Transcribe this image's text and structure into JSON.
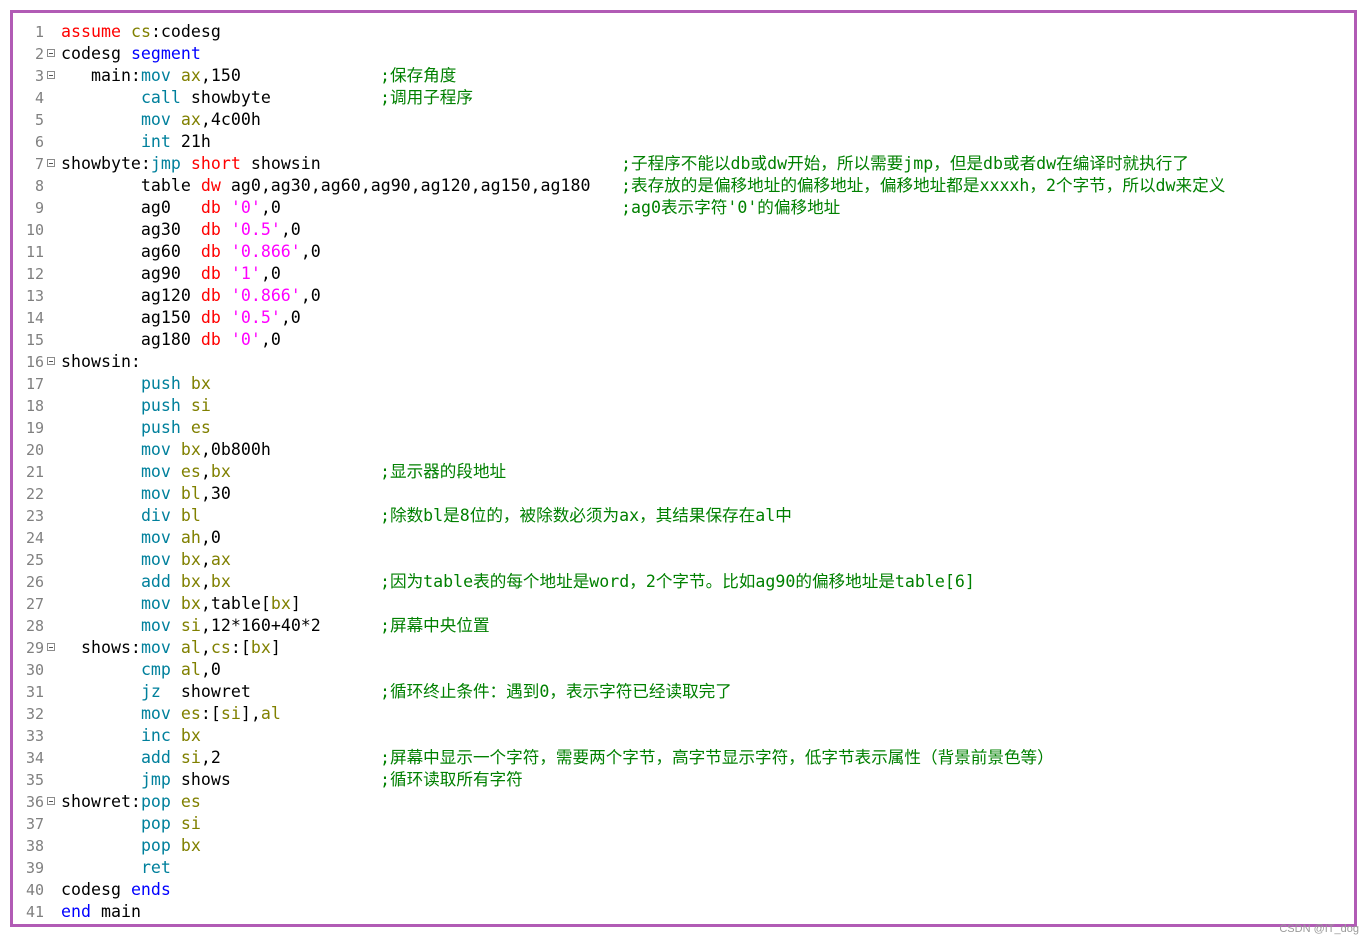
{
  "colors": {
    "border": "#b15bb5",
    "line_number": "#808080",
    "keyword": "#0000ff",
    "instruction": "#00809c",
    "directive_red": "#ff0000",
    "register": "#808000",
    "string": "#ff00ff",
    "comment": "#008000",
    "plain": "#000000"
  },
  "editor": {
    "lines": [
      {
        "num": "1",
        "fold": false,
        "tokens": [
          {
            "t": "assume",
            "c": "r"
          },
          {
            "t": " ",
            "c": "p"
          },
          {
            "t": "cs",
            "c": "o"
          },
          {
            "t": ":codesg",
            "c": "p"
          }
        ],
        "comment": "",
        "col": 1
      },
      {
        "num": "2",
        "fold": true,
        "tokens": [
          {
            "t": "codesg ",
            "c": "p"
          },
          {
            "t": "segment",
            "c": "b"
          }
        ],
        "comment": "",
        "col": 1
      },
      {
        "num": "3",
        "fold": true,
        "tokens": [
          {
            "t": "   main:",
            "c": "p"
          },
          {
            "t": "mov",
            "c": "i"
          },
          {
            "t": " ",
            "c": "p"
          },
          {
            "t": "ax",
            "c": "o"
          },
          {
            "t": ",150",
            "c": "p"
          }
        ],
        "comment": ";保存角度",
        "col": 1
      },
      {
        "num": "4",
        "fold": false,
        "tokens": [
          {
            "t": "        ",
            "c": "p"
          },
          {
            "t": "call",
            "c": "i"
          },
          {
            "t": " showbyte",
            "c": "p"
          }
        ],
        "comment": ";调用子程序",
        "col": 1
      },
      {
        "num": "5",
        "fold": false,
        "tokens": [
          {
            "t": "        ",
            "c": "p"
          },
          {
            "t": "mov",
            "c": "i"
          },
          {
            "t": " ",
            "c": "p"
          },
          {
            "t": "ax",
            "c": "o"
          },
          {
            "t": ",4c00h",
            "c": "p"
          }
        ],
        "comment": "",
        "col": 1
      },
      {
        "num": "6",
        "fold": false,
        "tokens": [
          {
            "t": "        ",
            "c": "p"
          },
          {
            "t": "int",
            "c": "i"
          },
          {
            "t": " 21h",
            "c": "p"
          }
        ],
        "comment": "",
        "col": 1
      },
      {
        "num": "7",
        "fold": true,
        "tokens": [
          {
            "t": "showbyte:",
            "c": "p"
          },
          {
            "t": "jmp",
            "c": "i"
          },
          {
            "t": " ",
            "c": "p"
          },
          {
            "t": "short",
            "c": "r"
          },
          {
            "t": " showsin",
            "c": "p"
          }
        ],
        "comment": ";子程序不能以db或dw开始，所以需要jmp，但是db或者dw在编译时就执行了",
        "col": 2
      },
      {
        "num": "8",
        "fold": false,
        "tokens": [
          {
            "t": "        table ",
            "c": "p"
          },
          {
            "t": "dw",
            "c": "r"
          },
          {
            "t": " ag0,ag30,ag60,ag90,ag120,ag150,ag180",
            "c": "p"
          }
        ],
        "comment": ";表存放的是偏移地址的偏移地址，偏移地址都是xxxxh，2个字节，所以dw来定义",
        "col": 2
      },
      {
        "num": "9",
        "fold": false,
        "tokens": [
          {
            "t": "        ag0   ",
            "c": "p"
          },
          {
            "t": "db",
            "c": "r"
          },
          {
            "t": " ",
            "c": "p"
          },
          {
            "t": "'0'",
            "c": "s"
          },
          {
            "t": ",0",
            "c": "p"
          }
        ],
        "comment": ";ag0表示字符'0'的偏移地址",
        "col": 2
      },
      {
        "num": "10",
        "fold": false,
        "tokens": [
          {
            "t": "        ag30  ",
            "c": "p"
          },
          {
            "t": "db",
            "c": "r"
          },
          {
            "t": " ",
            "c": "p"
          },
          {
            "t": "'0.5'",
            "c": "s"
          },
          {
            "t": ",0",
            "c": "p"
          }
        ],
        "comment": "",
        "col": 2
      },
      {
        "num": "11",
        "fold": false,
        "tokens": [
          {
            "t": "        ag60  ",
            "c": "p"
          },
          {
            "t": "db",
            "c": "r"
          },
          {
            "t": " ",
            "c": "p"
          },
          {
            "t": "'0.866'",
            "c": "s"
          },
          {
            "t": ",0",
            "c": "p"
          }
        ],
        "comment": "",
        "col": 2
      },
      {
        "num": "12",
        "fold": false,
        "tokens": [
          {
            "t": "        ag90  ",
            "c": "p"
          },
          {
            "t": "db",
            "c": "r"
          },
          {
            "t": " ",
            "c": "p"
          },
          {
            "t": "'1'",
            "c": "s"
          },
          {
            "t": ",0",
            "c": "p"
          }
        ],
        "comment": "",
        "col": 2
      },
      {
        "num": "13",
        "fold": false,
        "tokens": [
          {
            "t": "        ag120 ",
            "c": "p"
          },
          {
            "t": "db",
            "c": "r"
          },
          {
            "t": " ",
            "c": "p"
          },
          {
            "t": "'0.866'",
            "c": "s"
          },
          {
            "t": ",0",
            "c": "p"
          }
        ],
        "comment": "",
        "col": 2
      },
      {
        "num": "14",
        "fold": false,
        "tokens": [
          {
            "t": "        ag150 ",
            "c": "p"
          },
          {
            "t": "db",
            "c": "r"
          },
          {
            "t": " ",
            "c": "p"
          },
          {
            "t": "'0.5'",
            "c": "s"
          },
          {
            "t": ",0",
            "c": "p"
          }
        ],
        "comment": "",
        "col": 2
      },
      {
        "num": "15",
        "fold": false,
        "tokens": [
          {
            "t": "        ag180 ",
            "c": "p"
          },
          {
            "t": "db",
            "c": "r"
          },
          {
            "t": " ",
            "c": "p"
          },
          {
            "t": "'0'",
            "c": "s"
          },
          {
            "t": ",0",
            "c": "p"
          }
        ],
        "comment": "",
        "col": 2
      },
      {
        "num": "16",
        "fold": true,
        "tokens": [
          {
            "t": "showsin:",
            "c": "p"
          }
        ],
        "comment": "",
        "col": 1
      },
      {
        "num": "17",
        "fold": false,
        "tokens": [
          {
            "t": "        ",
            "c": "p"
          },
          {
            "t": "push",
            "c": "i"
          },
          {
            "t": " ",
            "c": "p"
          },
          {
            "t": "bx",
            "c": "o"
          }
        ],
        "comment": "",
        "col": 1
      },
      {
        "num": "18",
        "fold": false,
        "tokens": [
          {
            "t": "        ",
            "c": "p"
          },
          {
            "t": "push",
            "c": "i"
          },
          {
            "t": " ",
            "c": "p"
          },
          {
            "t": "si",
            "c": "o"
          }
        ],
        "comment": "",
        "col": 1
      },
      {
        "num": "19",
        "fold": false,
        "tokens": [
          {
            "t": "        ",
            "c": "p"
          },
          {
            "t": "push",
            "c": "i"
          },
          {
            "t": " ",
            "c": "p"
          },
          {
            "t": "es",
            "c": "o"
          }
        ],
        "comment": "",
        "col": 1
      },
      {
        "num": "20",
        "fold": false,
        "tokens": [
          {
            "t": "        ",
            "c": "p"
          },
          {
            "t": "mov",
            "c": "i"
          },
          {
            "t": " ",
            "c": "p"
          },
          {
            "t": "bx",
            "c": "o"
          },
          {
            "t": ",0b800h",
            "c": "p"
          }
        ],
        "comment": "",
        "col": 1
      },
      {
        "num": "21",
        "fold": false,
        "tokens": [
          {
            "t": "        ",
            "c": "p"
          },
          {
            "t": "mov",
            "c": "i"
          },
          {
            "t": " ",
            "c": "p"
          },
          {
            "t": "es",
            "c": "o"
          },
          {
            "t": ",",
            "c": "p"
          },
          {
            "t": "bx",
            "c": "o"
          }
        ],
        "comment": ";显示器的段地址",
        "col": 1
      },
      {
        "num": "22",
        "fold": false,
        "tokens": [
          {
            "t": "        ",
            "c": "p"
          },
          {
            "t": "mov",
            "c": "i"
          },
          {
            "t": " ",
            "c": "p"
          },
          {
            "t": "bl",
            "c": "o"
          },
          {
            "t": ",30",
            "c": "p"
          }
        ],
        "comment": "",
        "col": 1
      },
      {
        "num": "23",
        "fold": false,
        "tokens": [
          {
            "t": "        ",
            "c": "p"
          },
          {
            "t": "div",
            "c": "i"
          },
          {
            "t": " ",
            "c": "p"
          },
          {
            "t": "bl",
            "c": "o"
          }
        ],
        "comment": ";除数bl是8位的，被除数必须为ax，其结果保存在al中",
        "col": 1
      },
      {
        "num": "24",
        "fold": false,
        "tokens": [
          {
            "t": "        ",
            "c": "p"
          },
          {
            "t": "mov",
            "c": "i"
          },
          {
            "t": " ",
            "c": "p"
          },
          {
            "t": "ah",
            "c": "o"
          },
          {
            "t": ",0",
            "c": "p"
          }
        ],
        "comment": "",
        "col": 1
      },
      {
        "num": "25",
        "fold": false,
        "tokens": [
          {
            "t": "        ",
            "c": "p"
          },
          {
            "t": "mov",
            "c": "i"
          },
          {
            "t": " ",
            "c": "p"
          },
          {
            "t": "bx",
            "c": "o"
          },
          {
            "t": ",",
            "c": "p"
          },
          {
            "t": "ax",
            "c": "o"
          }
        ],
        "comment": "",
        "col": 1
      },
      {
        "num": "26",
        "fold": false,
        "tokens": [
          {
            "t": "        ",
            "c": "p"
          },
          {
            "t": "add",
            "c": "i"
          },
          {
            "t": " ",
            "c": "p"
          },
          {
            "t": "bx",
            "c": "o"
          },
          {
            "t": ",",
            "c": "p"
          },
          {
            "t": "bx",
            "c": "o"
          }
        ],
        "comment": ";因为table表的每个地址是word，2个字节。比如ag90的偏移地址是table[6]",
        "col": 1
      },
      {
        "num": "27",
        "fold": false,
        "tokens": [
          {
            "t": "        ",
            "c": "p"
          },
          {
            "t": "mov",
            "c": "i"
          },
          {
            "t": " ",
            "c": "p"
          },
          {
            "t": "bx",
            "c": "o"
          },
          {
            "t": ",table[",
            "c": "p"
          },
          {
            "t": "bx",
            "c": "o"
          },
          {
            "t": "]",
            "c": "p"
          }
        ],
        "comment": "",
        "col": 1
      },
      {
        "num": "28",
        "fold": false,
        "tokens": [
          {
            "t": "        ",
            "c": "p"
          },
          {
            "t": "mov",
            "c": "i"
          },
          {
            "t": " ",
            "c": "p"
          },
          {
            "t": "si",
            "c": "o"
          },
          {
            "t": ",12*160+40*2",
            "c": "p"
          }
        ],
        "comment": ";屏幕中央位置",
        "col": 1
      },
      {
        "num": "29",
        "fold": true,
        "tokens": [
          {
            "t": "  shows:",
            "c": "p"
          },
          {
            "t": "mov",
            "c": "i"
          },
          {
            "t": " ",
            "c": "p"
          },
          {
            "t": "al",
            "c": "o"
          },
          {
            "t": ",",
            "c": "p"
          },
          {
            "t": "cs",
            "c": "o"
          },
          {
            "t": ":[",
            "c": "p"
          },
          {
            "t": "bx",
            "c": "o"
          },
          {
            "t": "]",
            "c": "p"
          }
        ],
        "comment": "",
        "col": 1
      },
      {
        "num": "30",
        "fold": false,
        "tokens": [
          {
            "t": "        ",
            "c": "p"
          },
          {
            "t": "cmp",
            "c": "i"
          },
          {
            "t": " ",
            "c": "p"
          },
          {
            "t": "al",
            "c": "o"
          },
          {
            "t": ",0",
            "c": "p"
          }
        ],
        "comment": "",
        "col": 1
      },
      {
        "num": "31",
        "fold": false,
        "tokens": [
          {
            "t": "        ",
            "c": "p"
          },
          {
            "t": "jz",
            "c": "i"
          },
          {
            "t": "  showret",
            "c": "p"
          }
        ],
        "comment": ";循环终止条件：遇到0，表示字符已经读取完了",
        "col": 1
      },
      {
        "num": "32",
        "fold": false,
        "tokens": [
          {
            "t": "        ",
            "c": "p"
          },
          {
            "t": "mov",
            "c": "i"
          },
          {
            "t": " ",
            "c": "p"
          },
          {
            "t": "es",
            "c": "o"
          },
          {
            "t": ":[",
            "c": "p"
          },
          {
            "t": "si",
            "c": "o"
          },
          {
            "t": "],",
            "c": "p"
          },
          {
            "t": "al",
            "c": "o"
          }
        ],
        "comment": "",
        "col": 1
      },
      {
        "num": "33",
        "fold": false,
        "tokens": [
          {
            "t": "        ",
            "c": "p"
          },
          {
            "t": "inc",
            "c": "i"
          },
          {
            "t": " ",
            "c": "p"
          },
          {
            "t": "bx",
            "c": "o"
          }
        ],
        "comment": "",
        "col": 1
      },
      {
        "num": "34",
        "fold": false,
        "tokens": [
          {
            "t": "        ",
            "c": "p"
          },
          {
            "t": "add",
            "c": "i"
          },
          {
            "t": " ",
            "c": "p"
          },
          {
            "t": "si",
            "c": "o"
          },
          {
            "t": ",2",
            "c": "p"
          }
        ],
        "comment": ";屏幕中显示一个字符，需要两个字节，高字节显示字符，低字节表示属性（背景前景色等）",
        "col": 1
      },
      {
        "num": "35",
        "fold": false,
        "tokens": [
          {
            "t": "        ",
            "c": "p"
          },
          {
            "t": "jmp",
            "c": "i"
          },
          {
            "t": " shows",
            "c": "p"
          }
        ],
        "comment": ";循环读取所有字符",
        "col": 1
      },
      {
        "num": "36",
        "fold": true,
        "tokens": [
          {
            "t": "showret:",
            "c": "p"
          },
          {
            "t": "pop",
            "c": "i"
          },
          {
            "t": " ",
            "c": "p"
          },
          {
            "t": "es",
            "c": "o"
          }
        ],
        "comment": "",
        "col": 1
      },
      {
        "num": "37",
        "fold": false,
        "tokens": [
          {
            "t": "        ",
            "c": "p"
          },
          {
            "t": "pop",
            "c": "i"
          },
          {
            "t": " ",
            "c": "p"
          },
          {
            "t": "si",
            "c": "o"
          }
        ],
        "comment": "",
        "col": 1
      },
      {
        "num": "38",
        "fold": false,
        "tokens": [
          {
            "t": "        ",
            "c": "p"
          },
          {
            "t": "pop",
            "c": "i"
          },
          {
            "t": " ",
            "c": "p"
          },
          {
            "t": "bx",
            "c": "o"
          }
        ],
        "comment": "",
        "col": 1
      },
      {
        "num": "39",
        "fold": false,
        "tokens": [
          {
            "t": "        ",
            "c": "p"
          },
          {
            "t": "ret",
            "c": "i"
          }
        ],
        "comment": "",
        "col": 1
      },
      {
        "num": "40",
        "fold": false,
        "tokens": [
          {
            "t": "codesg ",
            "c": "p"
          },
          {
            "t": "ends",
            "c": "b"
          }
        ],
        "comment": "",
        "col": 1
      },
      {
        "num": "41",
        "fold": false,
        "tokens": [
          {
            "t": "end",
            "c": "b"
          },
          {
            "t": " main",
            "c": "p"
          }
        ],
        "comment": "",
        "col": 1
      }
    ]
  },
  "watermark": "CSDN @IT_dog"
}
